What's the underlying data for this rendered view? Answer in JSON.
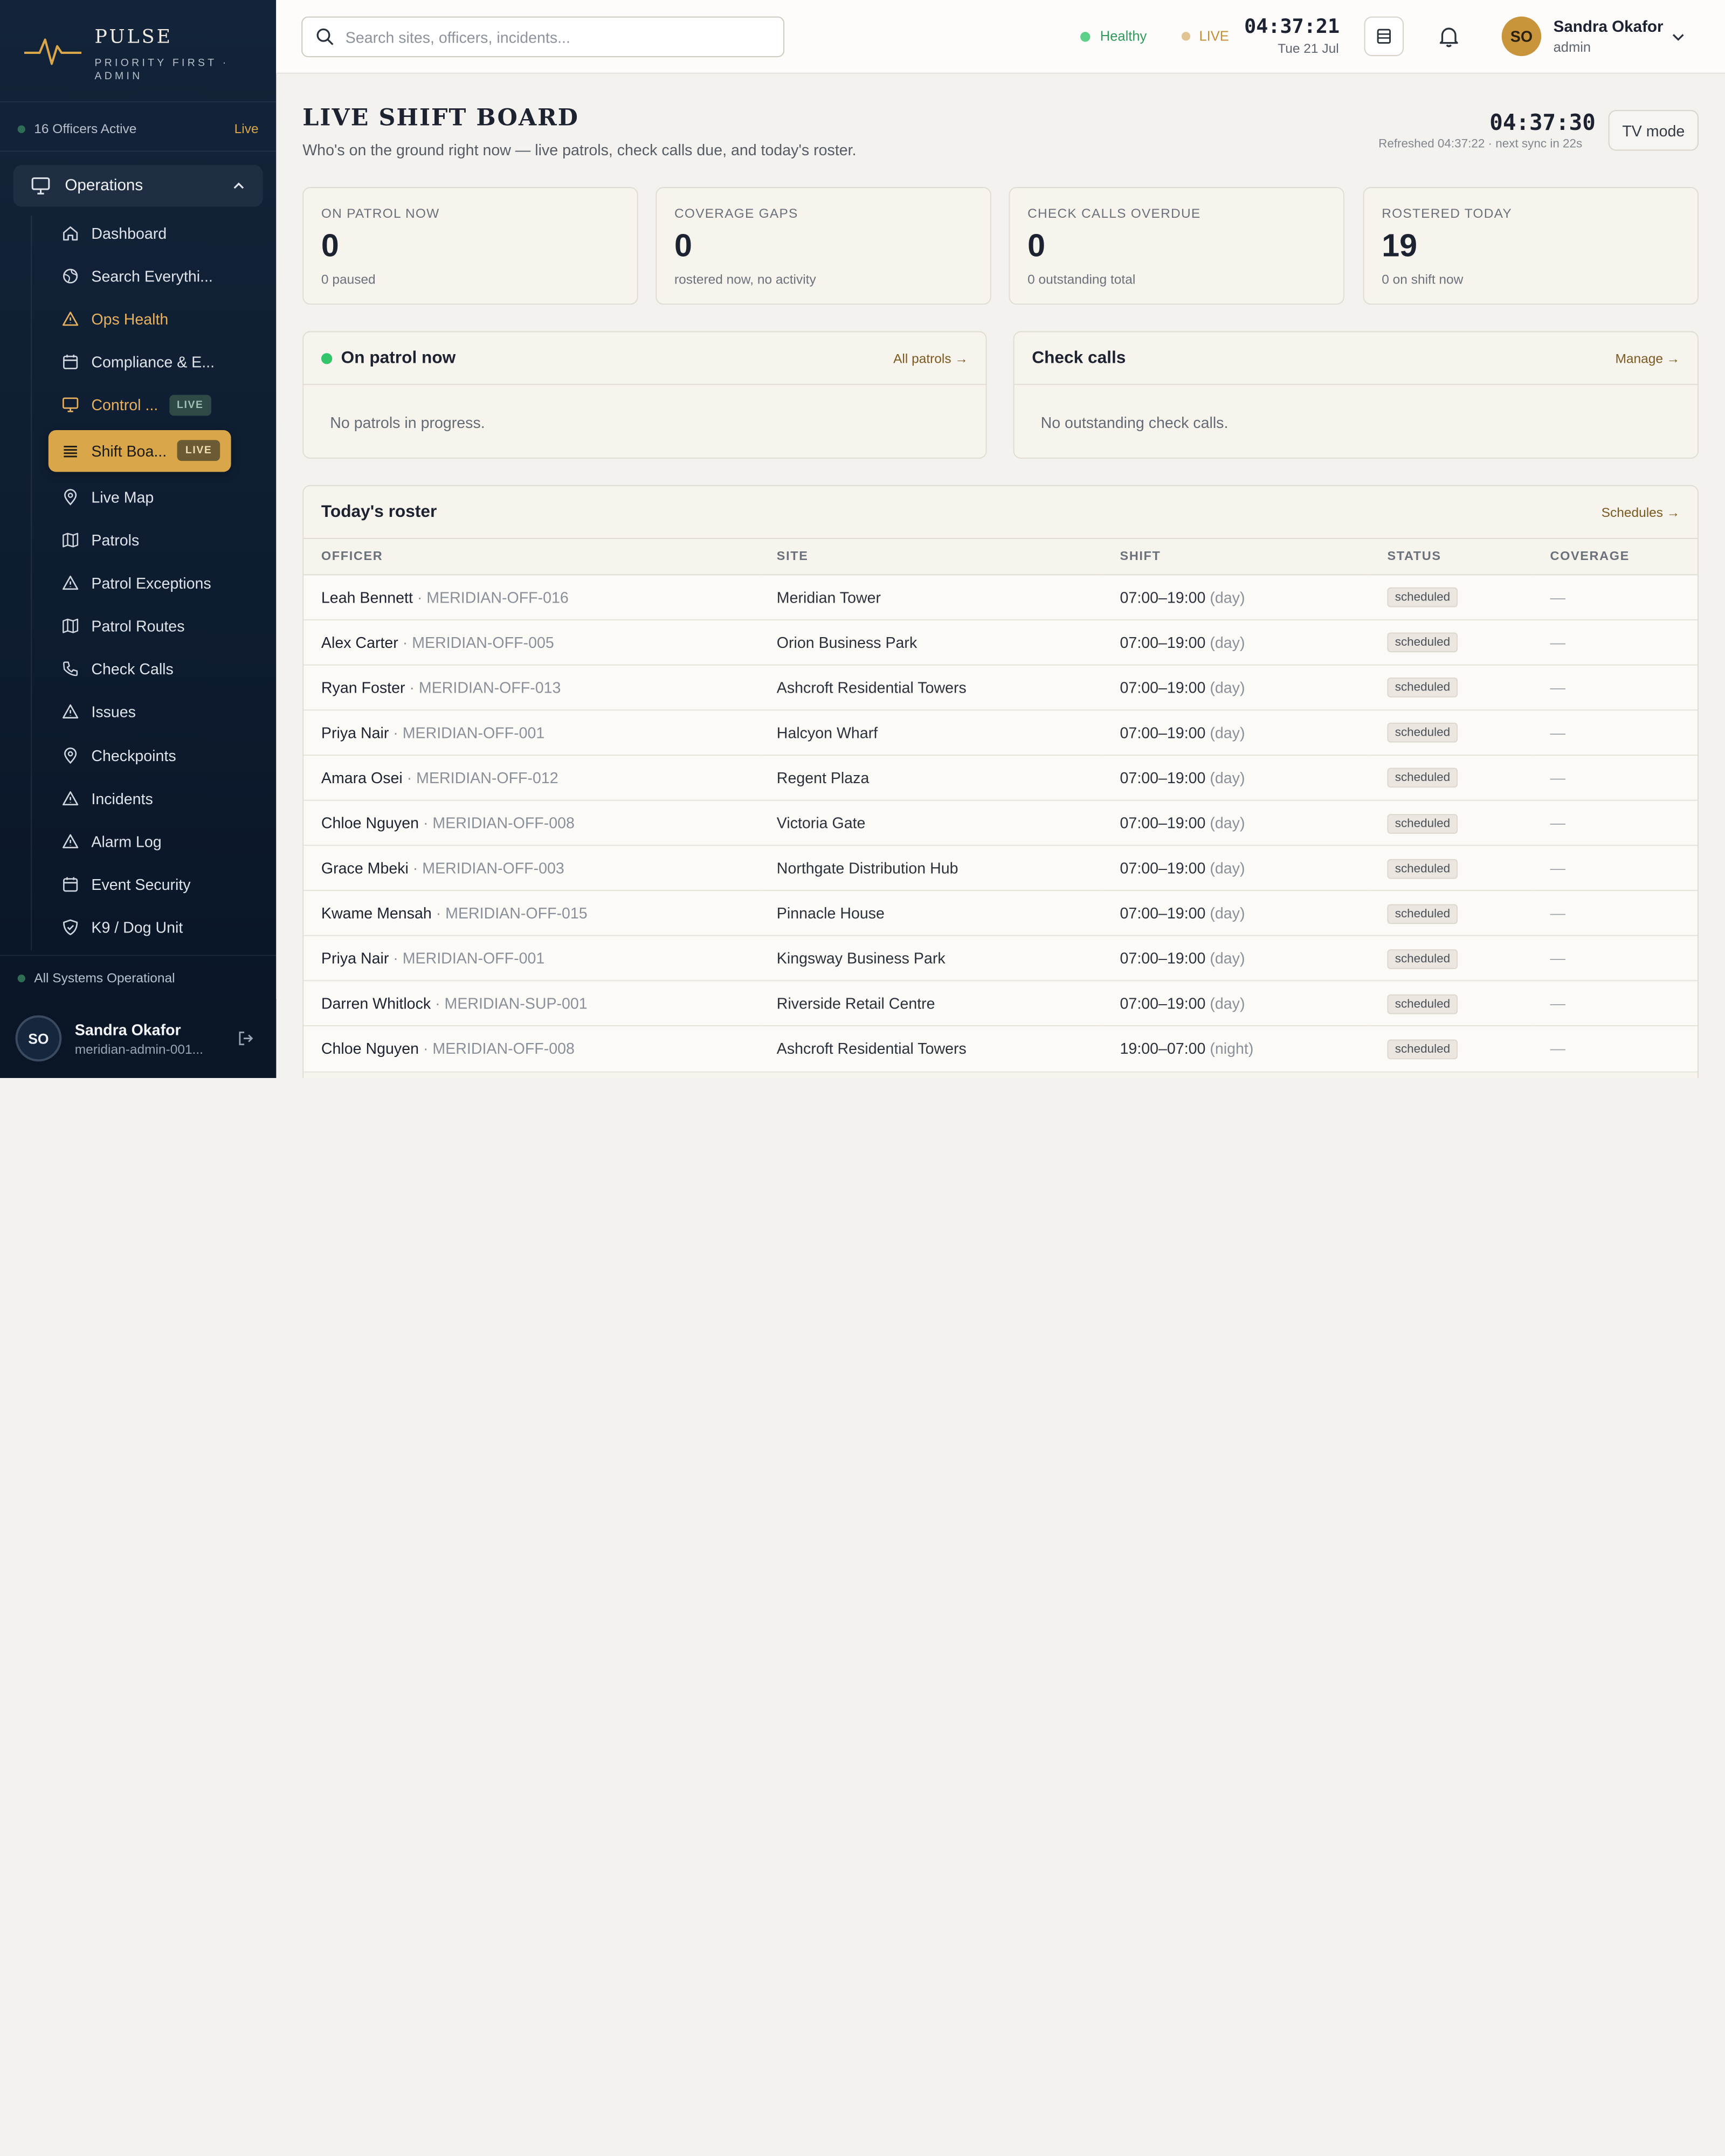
{
  "brand": {
    "name": "PULSE",
    "subtitle": "PRIORITY FIRST · ADMIN"
  },
  "sidebar": {
    "officers_active": "16 Officers Active",
    "live_label": "Live",
    "group_label": "Operations",
    "items": [
      {
        "label": "Dashboard",
        "icon": "home-icon"
      },
      {
        "label": "Search Everythi...",
        "icon": "globe-icon"
      },
      {
        "label": "Ops Health",
        "icon": "warning-icon"
      },
      {
        "label": "Compliance & E...",
        "icon": "calendar-icon"
      },
      {
        "label": "Control ...",
        "icon": "monitor-icon",
        "badge": "LIVE"
      },
      {
        "label": "Shift Boa...",
        "icon": "list-icon",
        "badge": "LIVE"
      },
      {
        "label": "Live Map",
        "icon": "map-pin-icon"
      },
      {
        "label": "Patrols",
        "icon": "map-icon"
      },
      {
        "label": "Patrol Exceptions",
        "icon": "warning-icon"
      },
      {
        "label": "Patrol Routes",
        "icon": "map-icon"
      },
      {
        "label": "Check Calls",
        "icon": "phone-icon"
      },
      {
        "label": "Issues",
        "icon": "warning-icon"
      },
      {
        "label": "Checkpoints",
        "icon": "map-pin-icon"
      },
      {
        "label": "Incidents",
        "icon": "warning-icon"
      },
      {
        "label": "Alarm Log",
        "icon": "warning-icon"
      },
      {
        "label": "Event Security",
        "icon": "calendar-icon"
      },
      {
        "label": "K9 / Dog Unit",
        "icon": "shield-icon"
      }
    ],
    "system_status": "All Systems Operational",
    "user": {
      "initials": "SO",
      "name": "Sandra Okafor",
      "sub": "meridian-admin-001..."
    }
  },
  "header": {
    "search_placeholder": "Search sites, officers, incidents...",
    "health": "Healthy",
    "live": "LIVE",
    "time": "04:37:21",
    "date": "Tue 21 Jul",
    "user": {
      "initials": "SO",
      "name": "Sandra Okafor",
      "role": "admin"
    }
  },
  "page": {
    "title": "LIVE SHIFT BOARD",
    "subtitle": "Who's on the ground right now — live patrols, check calls due, and today's roster.",
    "clock": "04:37:30",
    "refreshed": "Refreshed 04:37:22 · next sync in 22s",
    "tv_mode": "TV mode"
  },
  "stats": [
    {
      "label": "ON PATROL NOW",
      "value": "0",
      "sub": "0 paused"
    },
    {
      "label": "COVERAGE GAPS",
      "value": "0",
      "sub": "rostered now, no activity"
    },
    {
      "label": "CHECK CALLS OVERDUE",
      "value": "0",
      "sub": "0 outstanding total"
    },
    {
      "label": "ROSTERED TODAY",
      "value": "19",
      "sub": "0 on shift now"
    }
  ],
  "patrol_panel": {
    "title": "On patrol now",
    "link": "All patrols →",
    "empty": "No patrols in progress."
  },
  "checkcalls_panel": {
    "title": "Check calls",
    "link": "Manage →",
    "empty": "No outstanding check calls."
  },
  "roster": {
    "title": "Today's roster",
    "link": "Schedules →",
    "columns": [
      "OFFICER",
      "SITE",
      "SHIFT",
      "STATUS",
      "COVERAGE"
    ],
    "rows": [
      {
        "name": "Leah Bennett",
        "id": "· MERIDIAN-OFF-016",
        "site": "Meridian Tower",
        "shift": "07:00–19:00",
        "period": "(day)",
        "status": "scheduled",
        "coverage": "—"
      },
      {
        "name": "Alex Carter",
        "id": "· MERIDIAN-OFF-005",
        "site": "Orion Business Park",
        "shift": "07:00–19:00",
        "period": "(day)",
        "status": "scheduled",
        "coverage": "—"
      },
      {
        "name": "Ryan Foster",
        "id": "· MERIDIAN-OFF-013",
        "site": "Ashcroft Residential Towers",
        "shift": "07:00–19:00",
        "period": "(day)",
        "status": "scheduled",
        "coverage": "—"
      },
      {
        "name": "Priya Nair",
        "id": "· MERIDIAN-OFF-001",
        "site": "Halcyon Wharf",
        "shift": "07:00–19:00",
        "period": "(day)",
        "status": "scheduled",
        "coverage": "—"
      },
      {
        "name": "Amara Osei",
        "id": "· MERIDIAN-OFF-012",
        "site": "Regent Plaza",
        "shift": "07:00–19:00",
        "period": "(day)",
        "status": "scheduled",
        "coverage": "—"
      },
      {
        "name": "Chloe Nguyen",
        "id": "· MERIDIAN-OFF-008",
        "site": "Victoria Gate",
        "shift": "07:00–19:00",
        "period": "(day)",
        "status": "scheduled",
        "coverage": "—"
      },
      {
        "name": "Grace Mbeki",
        "id": "· MERIDIAN-OFF-003",
        "site": "Northgate Distribution Hub",
        "shift": "07:00–19:00",
        "period": "(day)",
        "status": "scheduled",
        "coverage": "—"
      },
      {
        "name": "Kwame Mensah",
        "id": "· MERIDIAN-OFF-015",
        "site": "Pinnacle House",
        "shift": "07:00–19:00",
        "period": "(day)",
        "status": "scheduled",
        "coverage": "—"
      },
      {
        "name": "Priya Nair",
        "id": "· MERIDIAN-OFF-001",
        "site": "Kingsway Business Park",
        "shift": "07:00–19:00",
        "period": "(day)",
        "status": "scheduled",
        "coverage": "—"
      },
      {
        "name": "Darren Whitlock",
        "id": "· MERIDIAN-SUP-001",
        "site": "Riverside Retail Centre",
        "shift": "07:00–19:00",
        "period": "(day)",
        "status": "scheduled",
        "coverage": "—"
      },
      {
        "name": "Chloe Nguyen",
        "id": "· MERIDIAN-OFF-008",
        "site": "Ashcroft Residential Towers",
        "shift": "19:00–07:00",
        "period": "(night)",
        "status": "scheduled",
        "coverage": "—"
      }
    ]
  },
  "colors": {
    "accent": "#d9a74a",
    "healthy": "#4ec27a",
    "live": "#d9a74a",
    "sidebar": "#0e1c30"
  }
}
